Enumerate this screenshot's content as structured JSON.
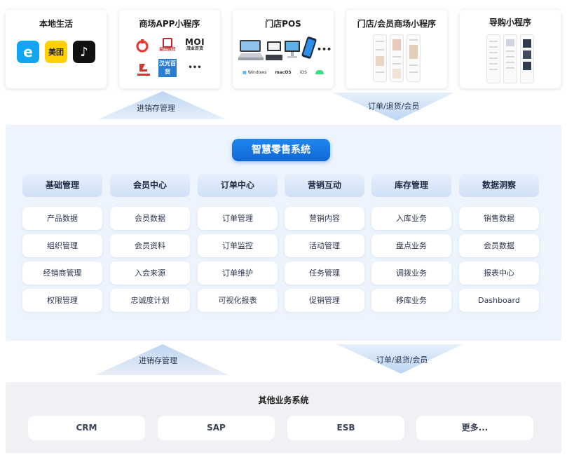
{
  "channels": {
    "local_life": {
      "title": "本地生活",
      "apps": [
        {
          "icon": "eleme-icon",
          "glyph": "e"
        },
        {
          "icon": "meituan-icon",
          "glyph": "美团"
        },
        {
          "icon": "douyin-icon",
          "glyph": "♪"
        }
      ]
    },
    "mall_app": {
      "title": "商场APP小程序",
      "logos": [
        "益田假日",
        "MOI",
        "汉光百货",
        "•••"
      ],
      "logo_sub": [
        "茂业百货"
      ]
    },
    "pos": {
      "title": "门店POS",
      "more": "•••",
      "os": [
        "Windows",
        "macOS",
        "iOS",
        "Android"
      ]
    },
    "member_mini": {
      "title": "门店/会员商场小程序"
    },
    "guide_mini": {
      "title": "导购小程序"
    }
  },
  "arrows": {
    "top_left": "进销存管理",
    "top_right": "订单/退货/会员",
    "bottom_left": "进销存管理",
    "bottom_right": "订单/退货/会员"
  },
  "colors": {
    "accent": "#1a73e8",
    "panel": "#edf4fd",
    "arrow": "#dbe8f8"
  },
  "system": {
    "title": "智慧零售系统",
    "modules": [
      {
        "name": "基础管理",
        "items": [
          "产品数据",
          "组织管理",
          "经销商管理",
          "权限管理"
        ]
      },
      {
        "name": "会员中心",
        "items": [
          "会员数据",
          "会员资料",
          "入会来源",
          "忠诚度计划"
        ]
      },
      {
        "name": "订单中心",
        "items": [
          "订单管理",
          "订单监控",
          "订单维护",
          "可视化报表"
        ]
      },
      {
        "name": "营销互动",
        "items": [
          "营销内容",
          "活动管理",
          "任务管理",
          "促销管理"
        ]
      },
      {
        "name": "库存管理",
        "items": [
          "入库业务",
          "盘点业务",
          "调拨业务",
          "移库业务"
        ]
      },
      {
        "name": "数据洞察",
        "items": [
          "销售数据",
          "会员数据",
          "报表中心",
          "Dashboard"
        ]
      }
    ]
  },
  "other": {
    "title": "其他业务系统",
    "items": [
      "CRM",
      "SAP",
      "ESB",
      "更多..."
    ]
  }
}
